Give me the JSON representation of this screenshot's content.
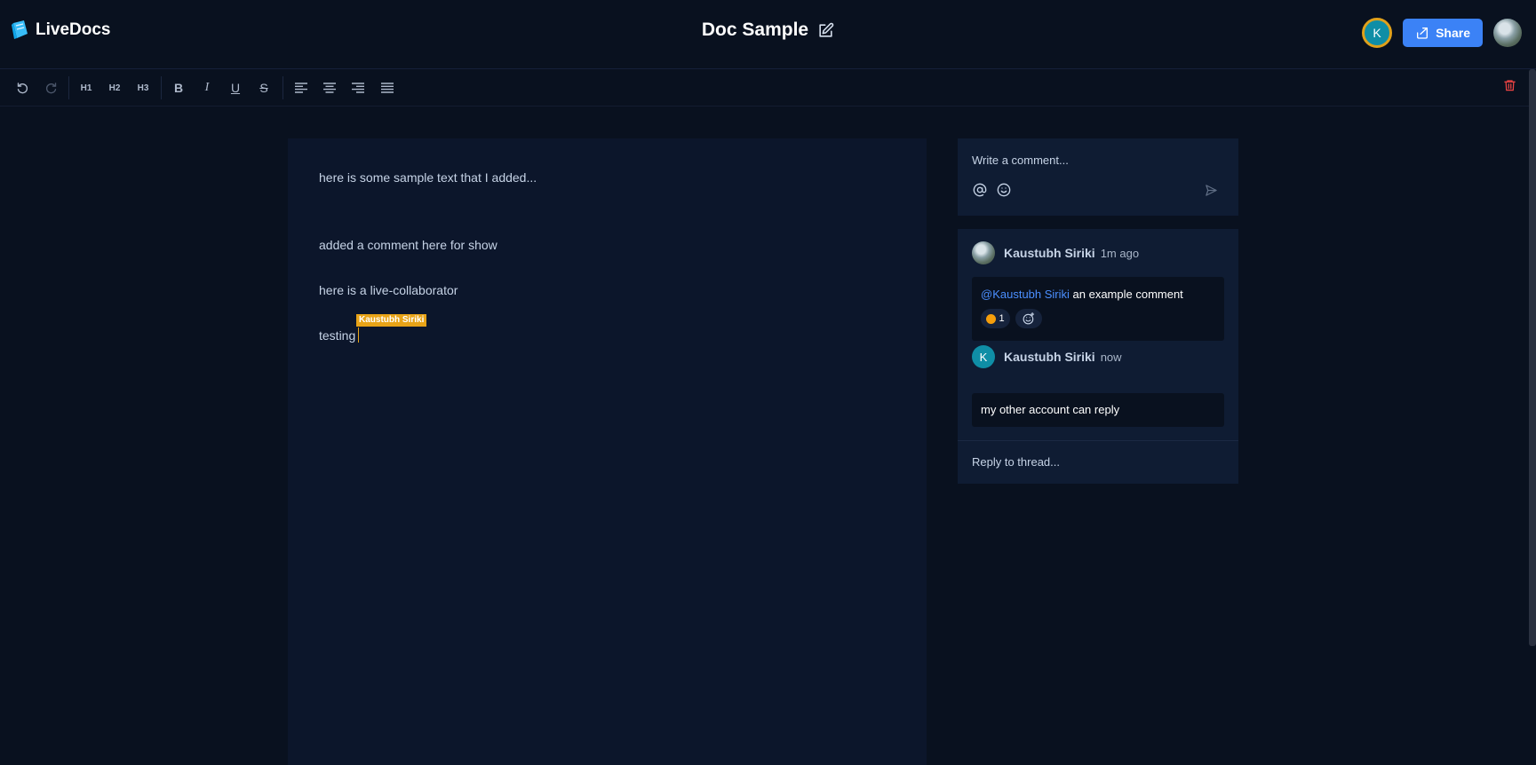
{
  "app": {
    "name": "LiveDocs"
  },
  "document": {
    "title": "Doc Sample"
  },
  "header": {
    "collaborator_initial": "K",
    "share_label": "Share"
  },
  "toolbar": {
    "items": [
      {
        "name": "undo",
        "icon": "undo-icon"
      },
      {
        "name": "redo",
        "icon": "redo-icon",
        "disabled": true
      },
      {
        "name": "h1",
        "label": "H1"
      },
      {
        "name": "h2",
        "label": "H2"
      },
      {
        "name": "h3",
        "label": "H3"
      },
      {
        "name": "bold",
        "label": "B"
      },
      {
        "name": "italic",
        "label": "I"
      },
      {
        "name": "underline",
        "label": "U"
      },
      {
        "name": "strikethrough",
        "label": "S"
      },
      {
        "name": "align-left",
        "icon": "align-left-icon"
      },
      {
        "name": "align-center",
        "icon": "align-center-icon"
      },
      {
        "name": "align-right",
        "icon": "align-right-icon"
      },
      {
        "name": "align-justify",
        "icon": "align-justify-icon"
      }
    ],
    "delete_icon": "trash-icon",
    "delete_color": "#ef4444"
  },
  "editor": {
    "paragraphs": [
      "here is some sample text that I added...",
      "added a comment here for show",
      "here is a live-collaborator",
      "testing"
    ],
    "live_cursor": {
      "user": "Kaustubh Siriki",
      "color": "#e8a317"
    }
  },
  "comments": {
    "composer_placeholder": "Write a comment...",
    "thread": [
      {
        "author": "Kaustubh Siriki",
        "time": "1m ago",
        "mention": "@Kaustubh Siriki",
        "text": " an example comment",
        "reaction_count": "1"
      },
      {
        "author": "Kaustubh Siriki",
        "initial": "K",
        "time": "now",
        "text": "my other account can reply"
      }
    ],
    "reply_placeholder": "Reply to thread..."
  },
  "colors": {
    "accent": "#3b82f6",
    "background": "#09111f",
    "panel": "#0f1c33"
  }
}
